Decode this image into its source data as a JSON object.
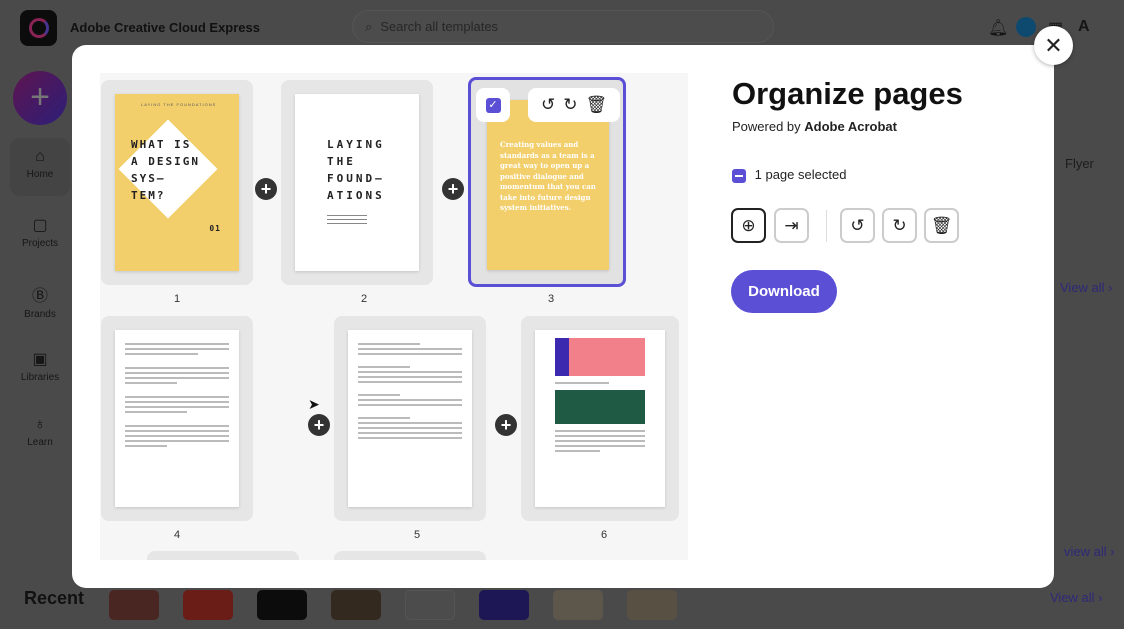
{
  "app": {
    "title": "Adobe Creative Cloud Express",
    "search_placeholder": "Search all templates"
  },
  "sidebar": {
    "create_label": "+",
    "items": [
      {
        "label": "Home",
        "icon": "⌂"
      },
      {
        "label": "Projects",
        "icon": "▢"
      },
      {
        "label": "Brands",
        "icon": "Ⓑ"
      },
      {
        "label": "Libraries",
        "icon": "▣"
      },
      {
        "label": "Learn",
        "icon": "♁"
      }
    ]
  },
  "background": {
    "flyer_label": "Flyer",
    "view_all": "View all ›",
    "view_all_2": "view all ›",
    "recent_label": "Recent",
    "recent_view_all": "View all ›"
  },
  "modal": {
    "title": "Organize pages",
    "powered_prefix": "Powered by ",
    "powered_brand": "Adobe Acrobat",
    "selection_text": "1 page selected",
    "download_label": "Download",
    "close_icon": "✕",
    "accent": "#5b4fd6",
    "pages": [
      {
        "number": "1",
        "header": "LAYING THE FOUNDATIONS",
        "title": "WHAT IS A DESIGN SYS— TEM?",
        "issue": "01"
      },
      {
        "number": "2",
        "title": "LAYING THE FOUND— ATIONS"
      },
      {
        "number": "3",
        "text": "Creating values and standards as a team is a great way to open up a positive dialogue and momentum that you can take into future design system initiatives.",
        "selected": true
      },
      {
        "number": "4"
      },
      {
        "number": "5"
      },
      {
        "number": "6"
      }
    ]
  }
}
